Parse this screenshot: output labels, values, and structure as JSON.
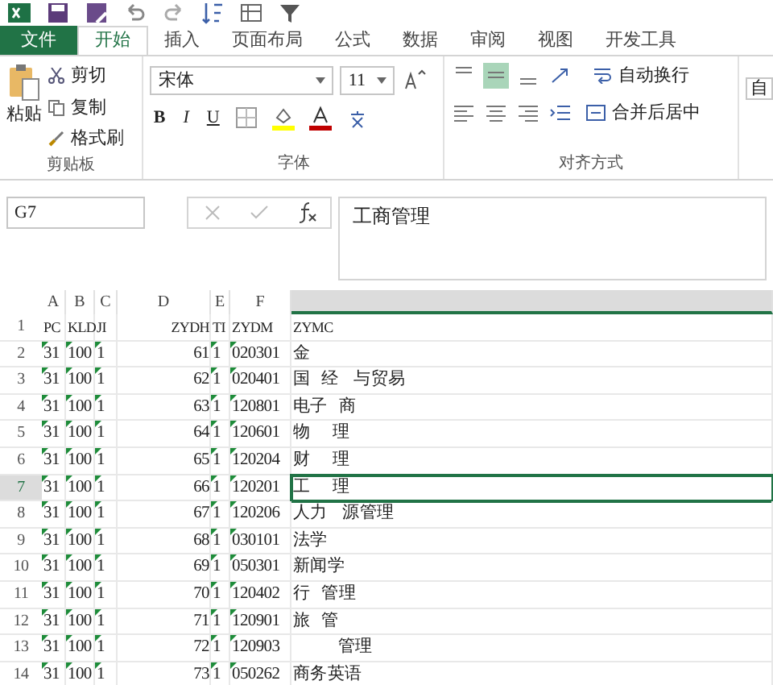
{
  "ribbon_tabs": [
    {
      "label": "文件",
      "kind": "file",
      "selected": false
    },
    {
      "label": "开始",
      "kind": "tab",
      "selected": true
    },
    {
      "label": "插入",
      "kind": "tab",
      "selected": false
    },
    {
      "label": "页面布局",
      "kind": "tab",
      "selected": false
    },
    {
      "label": "公式",
      "kind": "tab",
      "selected": false
    },
    {
      "label": "数据",
      "kind": "tab",
      "selected": false
    },
    {
      "label": "审阅",
      "kind": "tab",
      "selected": false
    },
    {
      "label": "视图",
      "kind": "tab",
      "selected": false
    },
    {
      "label": "开发工具",
      "kind": "tab",
      "selected": false
    }
  ],
  "clipboard": {
    "paste": "粘贴",
    "cut": "剪切",
    "copy": "复制",
    "format_painter": "格式刷",
    "group": "剪贴板"
  },
  "font": {
    "name": "宋体",
    "size": "11",
    "bold": "B",
    "italic": "I",
    "underline": "U",
    "group": "字体"
  },
  "alignment": {
    "wrap": "自动换行",
    "merge": "合并后居中",
    "group": "对齐方式",
    "cut_off": "自"
  },
  "formula_bar": {
    "name_box": "G7",
    "formula": "工商管理"
  },
  "columns": [
    {
      "label": "A",
      "selected": false
    },
    {
      "label": "B",
      "selected": false
    },
    {
      "label": "C",
      "selected": false
    },
    {
      "label": "D",
      "selected": false
    },
    {
      "label": "E",
      "selected": false
    },
    {
      "label": "F",
      "selected": false
    },
    {
      "selected": true
    }
  ],
  "rows": [
    {
      "num": "1",
      "selected": false,
      "text_flag": false,
      "cells": [
        "PC",
        "KLD",
        "JI",
        "ZYDH",
        "TI",
        "ZYDM",
        "ZYMC"
      ]
    },
    {
      "num": "2",
      "selected": false,
      "text_flag": true,
      "cells": [
        "31",
        "100",
        "1",
        "61",
        "1",
        "020301",
        "金"
      ]
    },
    {
      "num": "3",
      "selected": false,
      "text_flag": true,
      "cells": [
        "31",
        "100",
        "1",
        "62",
        "1",
        "020401",
        "国   经    与贸易"
      ]
    },
    {
      "num": "4",
      "selected": false,
      "text_flag": true,
      "cells": [
        "31",
        "100",
        "1",
        "63",
        "1",
        "120801",
        "电子   商"
      ]
    },
    {
      "num": "5",
      "selected": false,
      "text_flag": true,
      "cells": [
        "31",
        "100",
        "1",
        "64",
        "1",
        "120601",
        "物      理"
      ]
    },
    {
      "num": "6",
      "selected": false,
      "text_flag": true,
      "cells": [
        "31",
        "100",
        "1",
        "65",
        "1",
        "120204",
        "财      理"
      ]
    },
    {
      "num": "7",
      "selected": true,
      "text_flag": true,
      "cells": [
        "31",
        "100",
        "1",
        "66",
        "1",
        "120201",
        "工      理"
      ]
    },
    {
      "num": "8",
      "selected": false,
      "text_flag": true,
      "cells": [
        "31",
        "100",
        "1",
        "67",
        "1",
        "120206",
        "人力    源管理"
      ]
    },
    {
      "num": "9",
      "selected": false,
      "text_flag": true,
      "cells": [
        "31",
        "100",
        "1",
        "68",
        "1",
        "030101",
        "法学"
      ]
    },
    {
      "num": "10",
      "selected": false,
      "text_flag": true,
      "cells": [
        "31",
        "100",
        "1",
        "69",
        "1",
        "050301",
        "新闻学"
      ]
    },
    {
      "num": "11",
      "selected": false,
      "text_flag": true,
      "cells": [
        "31",
        "100",
        "1",
        "70",
        "1",
        "120402",
        "行   管理"
      ]
    },
    {
      "num": "12",
      "selected": false,
      "text_flag": true,
      "cells": [
        "31",
        "100",
        "1",
        "71",
        "1",
        "120901",
        "旅   管"
      ]
    },
    {
      "num": "13",
      "selected": false,
      "text_flag": true,
      "cells": [
        "31",
        "100",
        "1",
        "72",
        "1",
        "120903",
        "            管理"
      ]
    },
    {
      "num": "14",
      "selected": false,
      "text_flag": true,
      "cells": [
        "31",
        "100",
        "1",
        "73",
        "1",
        "050262",
        "商务英语"
      ]
    }
  ]
}
